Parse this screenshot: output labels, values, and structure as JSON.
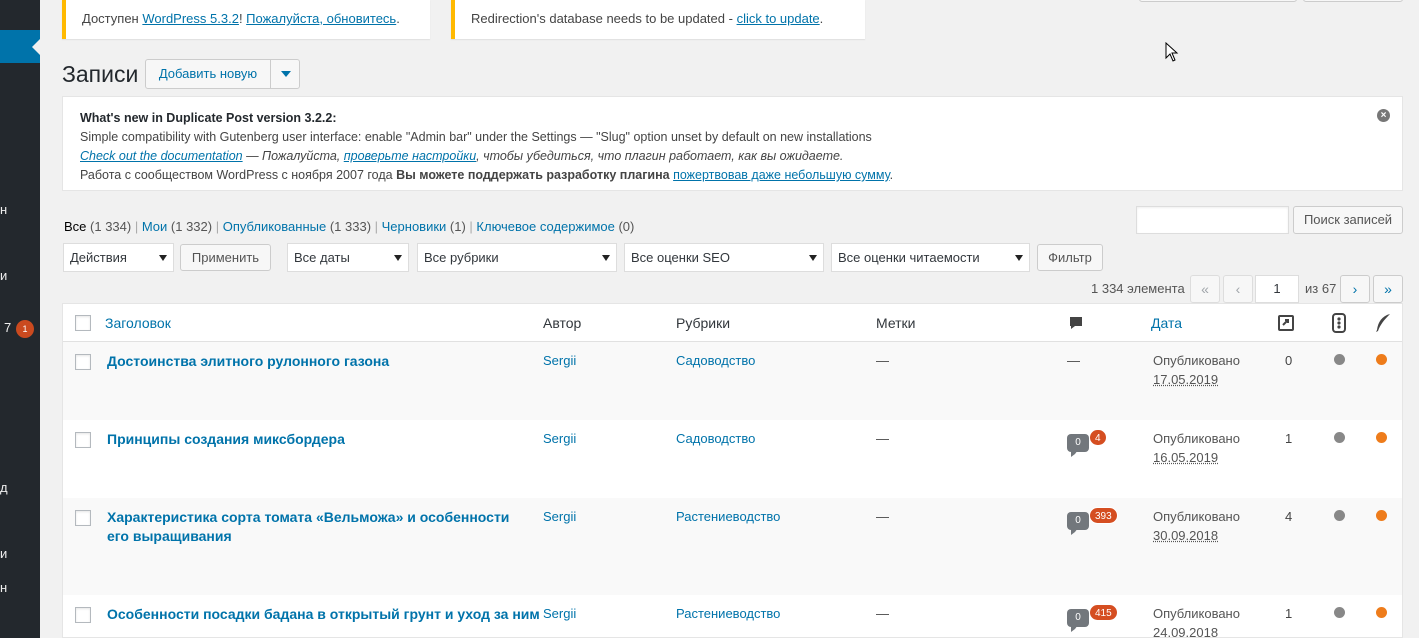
{
  "sidebar": {
    "fragments": [
      "н",
      "и",
      "7",
      "д",
      "и",
      "н"
    ],
    "badge": "1"
  },
  "notices": {
    "wp_prefix": "Доступен ",
    "wp_version_link": "WordPress 5.3.2",
    "wp_sep": "! ",
    "wp_update_link": "Пожалуйста, обновитесь",
    "wp_end": ".",
    "redir_text": "Redirection's database needs to be updated - ",
    "redir_link": "click to update",
    "redir_end": "."
  },
  "heading": {
    "title": "Записи",
    "add_new": "Добавить новую"
  },
  "duplicate_post": {
    "title": "What's new in Duplicate Post version 3.2.2:",
    "line1": "Simple compatibility with Gutenberg user interface: enable \"Admin bar\" under the Settings — \"Slug\" option unset by default on new installations",
    "doc_link": "Check out the documentation",
    "line2_mid": " — Пожалуйста, ",
    "settings_link": "проверьте настройки",
    "line2_end": ", чтобы убедиться, что плагин работает, как вы ожидаете.",
    "line3_start": "Работа с сообществом WordPress с ноября 2007 года ",
    "line3_bold": "Вы можете поддержать разработку плагина ",
    "donate_link": "пожертвовав даже небольшую сумму",
    "line3_end": ".",
    "close": "×"
  },
  "views": [
    {
      "label": "Все",
      "count": " (1 334)"
    },
    {
      "label": "Мои",
      "count": " (1 332)"
    },
    {
      "label": "Опубликованные",
      "count": " (1 333)"
    },
    {
      "label": "Черновики",
      "count": " (1)"
    },
    {
      "label": "Ключевое содержимое",
      "count": " (0)"
    }
  ],
  "search": {
    "button": "Поиск записей",
    "value": ""
  },
  "filters": {
    "bulk": "Действия",
    "apply": "Применить",
    "dates": "Все даты",
    "cats": "Все рубрики",
    "seo": "Все оценки SEO",
    "read": "Все оценки читаемости",
    "filter": "Фильтр"
  },
  "pagination": {
    "items": "1 334 элемента",
    "first": "«",
    "prev": "‹",
    "current": "1",
    "of": "из 67",
    "next": "›",
    "last": "»"
  },
  "table": {
    "headers": {
      "title": "Заголовок",
      "author": "Автор",
      "cats": "Рубрики",
      "tags": "Метки",
      "date": "Дата"
    },
    "rows": [
      {
        "title": "Достоинства элитного рулонного газона",
        "author": "Sergii",
        "cat": "Садоводство",
        "tags": "—",
        "comments": "—",
        "pending": "",
        "status": "Опубликовано",
        "date": "17.05.2019",
        "links": "0"
      },
      {
        "title": "Принципы создания миксбордера",
        "author": "Sergii",
        "cat": "Садоводство",
        "tags": "—",
        "comments": "0",
        "pending": "4",
        "status": "Опубликовано",
        "date": "16.05.2019",
        "links": "1"
      },
      {
        "title": "Характеристика сорта томата «Вельможа» и особенности его выращивания",
        "author": "Sergii",
        "cat": "Растениеводство",
        "tags": "—",
        "comments": "0",
        "pending": "393",
        "status": "Опубликовано",
        "date": "30.09.2018",
        "links": "4"
      },
      {
        "title": "Особенности посадки бадана в открытый грунт и уход за ним",
        "author": "Sergii",
        "cat": "Растениеводство",
        "tags": "—",
        "comments": "0",
        "pending": "415",
        "status": "Опубликовано",
        "date": "24.09.2018",
        "links": "1"
      }
    ]
  },
  "colors": {
    "seo_dot": "#888888",
    "readability_dot": "#ee7c1b",
    "accent": "#0073aa",
    "sidebar": "#23282d"
  }
}
